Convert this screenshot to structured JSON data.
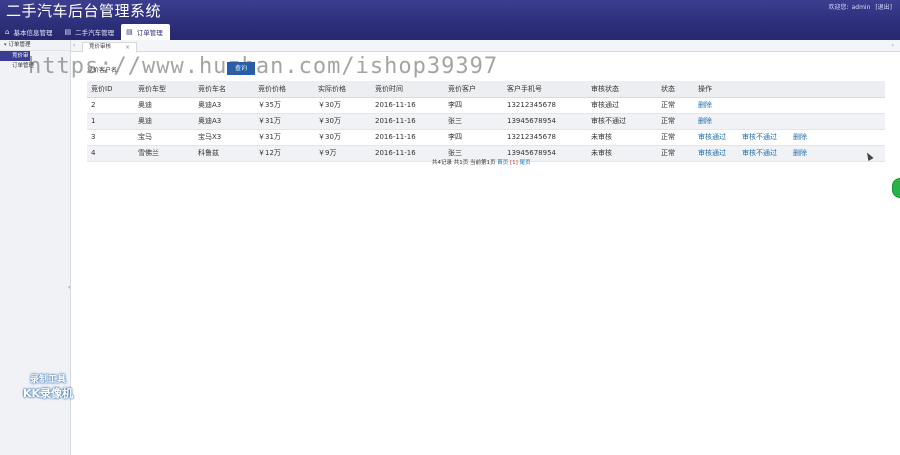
{
  "header": {
    "title": "二手汽车后台管理系统",
    "welcome": "欢迎您:",
    "username": "admin",
    "logout": "[退出]"
  },
  "topnav": [
    {
      "label": "基本信息管理",
      "icon": "house-icon"
    },
    {
      "label": "二手汽车管理",
      "icon": "window-icon"
    },
    {
      "label": "订单管理",
      "icon": "window-icon"
    }
  ],
  "sidebar": {
    "group": "订单管理",
    "items": [
      "竞价审核",
      "订单管理"
    ]
  },
  "tab": {
    "label": "竞价审核",
    "close": "×"
  },
  "search": {
    "label": "竞价客户名:",
    "button": "查询"
  },
  "table": {
    "headers": [
      "竞价ID",
      "竞价车型",
      "竞价车名",
      "竞价价格",
      "实际价格",
      "竞价时间",
      "竞价客户",
      "客户手机号",
      "审核状态",
      "状态",
      "操作"
    ],
    "rows": [
      {
        "cells": [
          "2",
          "奥迪",
          "奥迪A3",
          "￥35万",
          "￥30万",
          "2016-11-16",
          "李四",
          "13212345678",
          "审核通过",
          "正常"
        ],
        "actions": [
          "删除"
        ]
      },
      {
        "cells": [
          "1",
          "奥迪",
          "奥迪A3",
          "￥31万",
          "￥30万",
          "2016-11-16",
          "张三",
          "13945678954",
          "审核不通过",
          "正常"
        ],
        "actions": [
          "删除"
        ]
      },
      {
        "cells": [
          "3",
          "宝马",
          "宝马X3",
          "￥31万",
          "￥30万",
          "2016-11-16",
          "李四",
          "13212345678",
          "未审核",
          "正常"
        ],
        "actions": [
          "审核通过",
          "审核不通过",
          "删除"
        ]
      },
      {
        "cells": [
          "4",
          "雪佛兰",
          "科鲁兹",
          "￥12万",
          "￥9万",
          "2016-11-16",
          "张三",
          "13945678954",
          "未审核",
          "正常"
        ],
        "actions": [
          "审核通过",
          "审核不通过",
          "删除"
        ]
      }
    ]
  },
  "pager": {
    "summary": "共4记录 共1页 当前第1页",
    "first": "首页",
    "current": "[1]",
    "last": "尾页"
  },
  "overlay": {
    "watermark": "https://www.huzhan.com/ishop39397",
    "rec_line1": "录制工具",
    "rec_line2": "KK录像机"
  },
  "colors": {
    "header": "#2d2f7a",
    "link": "#1c6fb0",
    "button": "#1f5fb4"
  }
}
